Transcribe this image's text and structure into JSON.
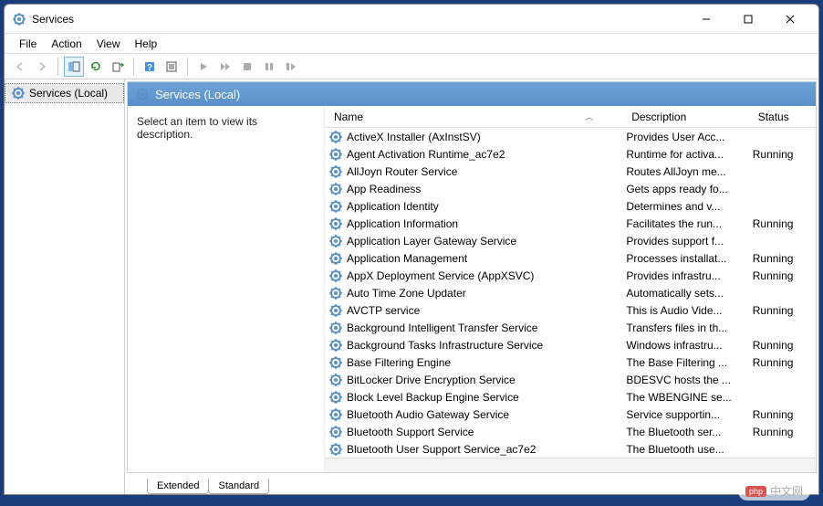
{
  "window": {
    "title": "Services"
  },
  "menu": {
    "file": "File",
    "action": "Action",
    "view": "View",
    "help": "Help"
  },
  "tree": {
    "root": "Services (Local)"
  },
  "header": {
    "title": "Services (Local)"
  },
  "desc_pane": {
    "prompt": "Select an item to view its description."
  },
  "columns": {
    "name": "Name",
    "description": "Description",
    "status": "Status"
  },
  "tabs": {
    "extended": "Extended",
    "standard": "Standard"
  },
  "watermark": {
    "badge": "php",
    "text": "中文网"
  },
  "services": [
    {
      "name": "ActiveX Installer (AxInstSV)",
      "desc": "Provides User Acc...",
      "status": ""
    },
    {
      "name": "Agent Activation Runtime_ac7e2",
      "desc": "Runtime for activa...",
      "status": "Running"
    },
    {
      "name": "AllJoyn Router Service",
      "desc": "Routes AllJoyn me...",
      "status": ""
    },
    {
      "name": "App Readiness",
      "desc": "Gets apps ready fo...",
      "status": ""
    },
    {
      "name": "Application Identity",
      "desc": "Determines and v...",
      "status": ""
    },
    {
      "name": "Application Information",
      "desc": "Facilitates the run...",
      "status": "Running"
    },
    {
      "name": "Application Layer Gateway Service",
      "desc": "Provides support f...",
      "status": ""
    },
    {
      "name": "Application Management",
      "desc": "Processes installat...",
      "status": "Running"
    },
    {
      "name": "AppX Deployment Service (AppXSVC)",
      "desc": "Provides infrastru...",
      "status": "Running"
    },
    {
      "name": "Auto Time Zone Updater",
      "desc": "Automatically sets...",
      "status": ""
    },
    {
      "name": "AVCTP service",
      "desc": "This is Audio Vide...",
      "status": "Running"
    },
    {
      "name": "Background Intelligent Transfer Service",
      "desc": "Transfers files in th...",
      "status": ""
    },
    {
      "name": "Background Tasks Infrastructure Service",
      "desc": "Windows infrastru...",
      "status": "Running"
    },
    {
      "name": "Base Filtering Engine",
      "desc": "The Base Filtering ...",
      "status": "Running"
    },
    {
      "name": "BitLocker Drive Encryption Service",
      "desc": "BDESVC hosts the ...",
      "status": ""
    },
    {
      "name": "Block Level Backup Engine Service",
      "desc": "The WBENGINE se...",
      "status": ""
    },
    {
      "name": "Bluetooth Audio Gateway Service",
      "desc": "Service supportin...",
      "status": "Running"
    },
    {
      "name": "Bluetooth Support Service",
      "desc": "The Bluetooth ser...",
      "status": "Running"
    },
    {
      "name": "Bluetooth User Support Service_ac7e2",
      "desc": "The Bluetooth use...",
      "status": ""
    }
  ]
}
